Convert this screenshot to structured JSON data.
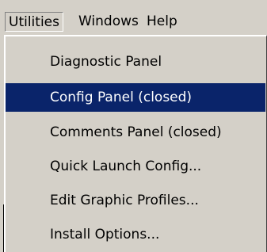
{
  "menubar": {
    "items": [
      {
        "label": "Utilities",
        "active": true
      },
      {
        "label": "Windows",
        "active": false
      },
      {
        "label": "Help",
        "active": false
      }
    ]
  },
  "dropdown": {
    "items": [
      {
        "label": "Diagnostic Panel",
        "highlighted": false
      },
      {
        "label": "Config Panel (closed)",
        "highlighted": true
      },
      {
        "label": "Comments Panel (closed)",
        "highlighted": false
      },
      {
        "label": "Quick Launch Config...",
        "highlighted": false
      },
      {
        "label": "Edit Graphic Profiles...",
        "highlighted": false
      },
      {
        "label": "Install Options...",
        "highlighted": false
      }
    ]
  },
  "colors": {
    "menu_background": "#d4d0c8",
    "highlight": "#0a246a",
    "highlight_text": "#ffffff"
  }
}
